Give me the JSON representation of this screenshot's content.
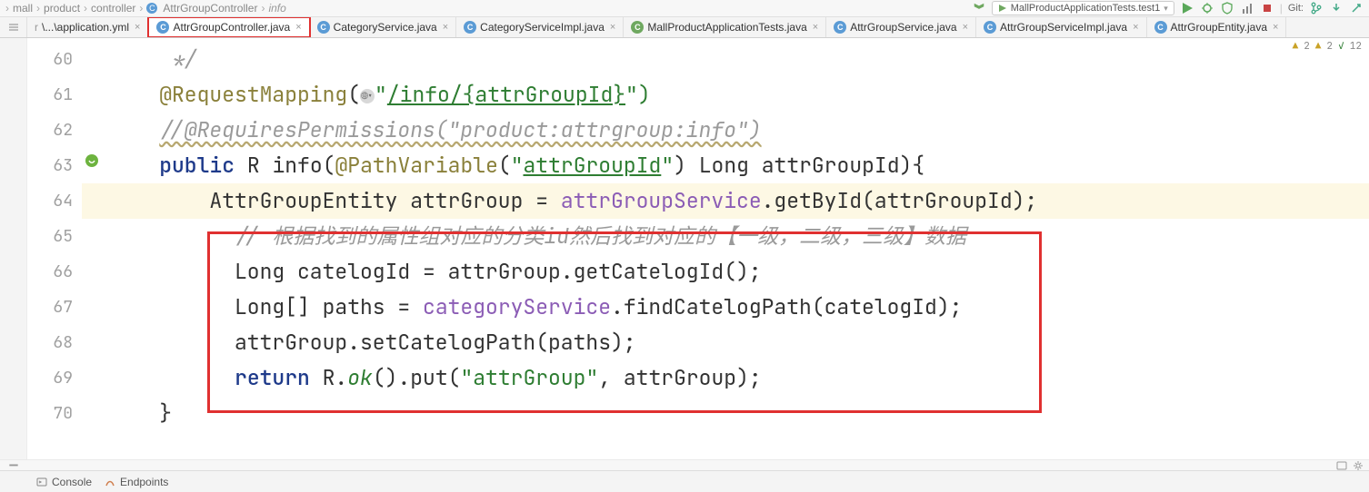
{
  "breadcrumbs": {
    "b1": "mall",
    "b2": "product",
    "b3": "controller",
    "b4": "AttrGroupController",
    "b5": "info"
  },
  "run_config": "MallProductApplicationTests.test1",
  "git_label": "Git:",
  "tabs": [
    {
      "label": "\\...\\application.yml",
      "type": "yml"
    },
    {
      "label": "AttrGroupController.java",
      "type": "java"
    },
    {
      "label": "CategoryService.java",
      "type": "java"
    },
    {
      "label": "CategoryServiceImpl.java",
      "type": "java"
    },
    {
      "label": "MallProductApplicationTests.java",
      "type": "ui"
    },
    {
      "label": "AttrGroupService.java",
      "type": "java"
    },
    {
      "label": "AttrGroupServiceImpl.java",
      "type": "java"
    },
    {
      "label": "AttrGroupEntity.java",
      "type": "java"
    }
  ],
  "status_badges": {
    "w1": "2",
    "w2": "2",
    "checks": "12"
  },
  "line_numbers": [
    "60",
    "61",
    "62",
    "63",
    "64",
    "65",
    "66",
    "67",
    "68",
    "69",
    "70"
  ],
  "code": {
    "r60": "     */",
    "r61_ann": "@RequestMapping",
    "r61_open": "(",
    "r61_url": "/info/{attrGroupId}",
    "r61_close": "\")",
    "r62": "//@RequiresPermissions(\"product:attrgroup:info\")",
    "r63_kw": "public",
    "r63_type": "R",
    "r63_fn": "info",
    "r63_ann": "@PathVariable",
    "r63_str": "attrGroupId",
    "r63_argtail": ") Long attrGroupId){",
    "r64_pre": "        AttrGroupEntity attrGroup = ",
    "r64_svc": "attrGroupService",
    "r64_tail": ".getById(attrGroupId);",
    "r65": "          // 根据找到的属性组对应的分类id然后找到对应的【一级，二级，三级】数据",
    "r66": "          Long catelogId = attrGroup.getCatelogId();",
    "r67_pre": "          Long[] paths = ",
    "r67_svc": "categoryService",
    "r67_tail": ".findCatelogPath(catelogId);",
    "r68": "          attrGroup.setCatelogPath(paths);",
    "r69_kw": "return",
    "r69_mid": " R.",
    "r69_ok": "ok",
    "r69_p1": "().put(",
    "r69_str": "\"attrGroup\"",
    "r69_tail": ", attrGroup);",
    "r70": "    }"
  },
  "bottom": {
    "console": "Console",
    "endpoints": "Endpoints"
  }
}
